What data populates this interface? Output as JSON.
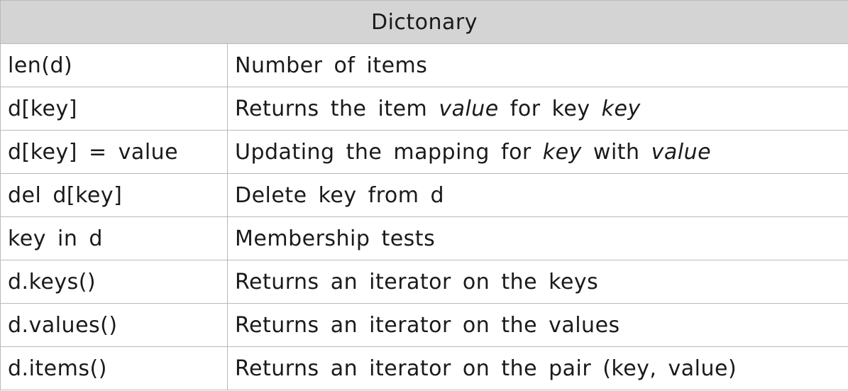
{
  "title": "Dictonary",
  "rows": [
    {
      "op": "len(d)",
      "desc": [
        "Number of items"
      ]
    },
    {
      "op": "d[key]",
      "desc": [
        "Returns the item ",
        {
          "i": "value"
        },
        " for key ",
        {
          "i": "key"
        }
      ]
    },
    {
      "op": "d[key] = value",
      "desc": [
        "Updating the mapping for ",
        {
          "i": "key"
        },
        " with ",
        {
          "i": "value"
        }
      ]
    },
    {
      "op": "del d[key]",
      "desc": [
        "Delete key from d"
      ]
    },
    {
      "op": "key in d",
      "desc": [
        "Membership tests"
      ]
    },
    {
      "op": "d.keys()",
      "desc": [
        "Returns an iterator on the keys"
      ]
    },
    {
      "op": "d.values()",
      "desc": [
        "Returns an iterator on the values"
      ]
    },
    {
      "op": "d.items()",
      "desc": [
        "Returns an iterator on the pair (key, value)"
      ]
    }
  ]
}
